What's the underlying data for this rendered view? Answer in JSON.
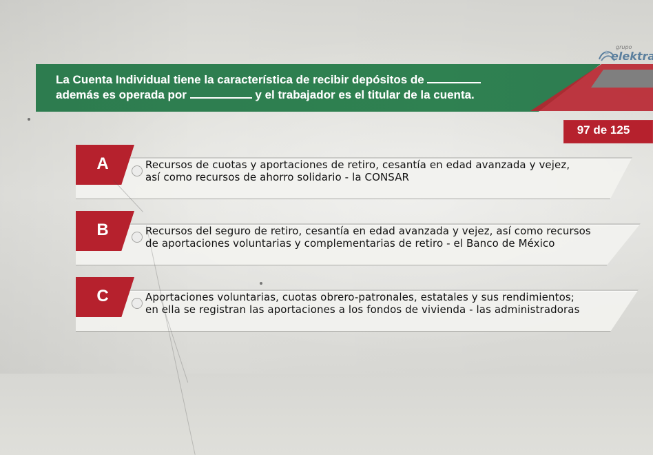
{
  "brand": {
    "small": "grupo",
    "name": "elektra",
    "icon": "elektra-logo-icon"
  },
  "question": {
    "line1_before": "La Cuenta Individual tiene la característica de recibir depósitos de",
    "line2_before": "además es operada por",
    "line2_after": "y el trabajador es el titular de la cuenta."
  },
  "progress": {
    "label": "97 de 125"
  },
  "options": [
    {
      "letter": "A",
      "line1": "Recursos de cuotas y aportaciones de retiro, cesantía en edad avanzada y vejez,",
      "line2": "así como recursos de ahorro solidario - la CONSAR"
    },
    {
      "letter": "B",
      "line1": "Recursos del seguro de retiro, cesantía en edad avanzada y vejez, así como recursos",
      "line2": "de aportaciones voluntarias y complementarias de retiro - el Banco de México"
    },
    {
      "letter": "C",
      "line1": "Aportaciones voluntarias, cuotas obrero-patronales, estatales y sus rendimientos;",
      "line2": "en ella se registran las aportaciones a los fondos de vivienda - las administradoras"
    }
  ],
  "colors": {
    "green": "#2e7d51",
    "red": "#b6212d",
    "text": "#111111",
    "white": "#ffffff"
  }
}
